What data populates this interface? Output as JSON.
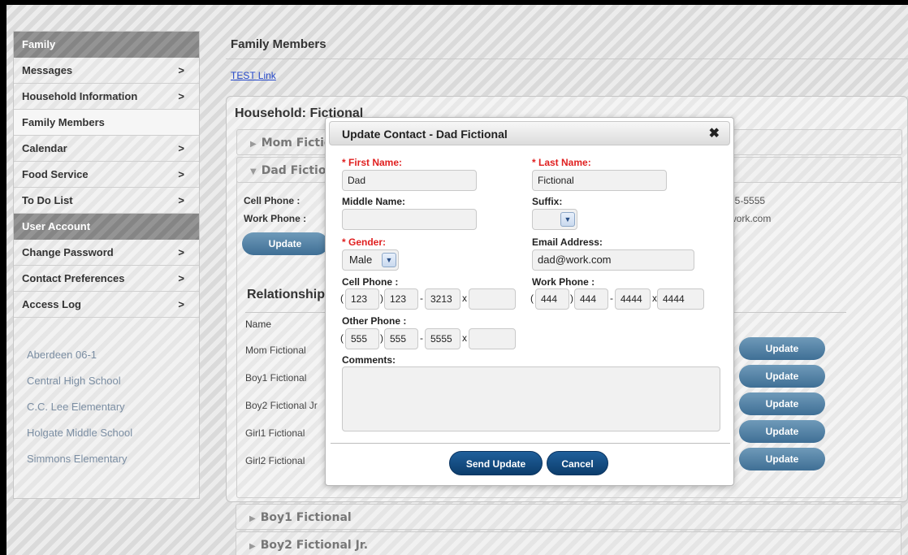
{
  "sidebar": {
    "family_header": "Family",
    "family_items": [
      {
        "label": "Messages",
        "chevron": ">"
      },
      {
        "label": "Household Information",
        "chevron": ">"
      },
      {
        "label": "Family Members",
        "chevron": ""
      },
      {
        "label": "Calendar",
        "chevron": ">"
      },
      {
        "label": "Food Service",
        "chevron": ">"
      },
      {
        "label": "To Do List",
        "chevron": ">"
      }
    ],
    "account_header": "User Account",
    "account_items": [
      {
        "label": "Change Password",
        "chevron": ">"
      },
      {
        "label": "Contact Preferences",
        "chevron": ">"
      },
      {
        "label": "Access Log",
        "chevron": ">"
      }
    ],
    "schools": [
      "Aberdeen 06-1",
      "Central High School",
      "C.C. Lee Elementary",
      "Holgate Middle School",
      "Simmons Elementary"
    ]
  },
  "main": {
    "title": "Family Members",
    "test_link": "TEST Link",
    "household_title": "Household: Fictional",
    "accordions": {
      "mom": "Mom Fictional",
      "dad": "Dad Fictional",
      "boy1": "Boy1 Fictional",
      "boy2": "Boy2 Fictional Jr."
    },
    "dad_details": {
      "cell_label": "Cell Phone :",
      "work_label": "Work Phone :",
      "cell_partial": "55-5555",
      "email_partial": "work.com",
      "update_label": "Update"
    },
    "relationships": {
      "title": "Relationships",
      "name_header": "Name",
      "rows": [
        {
          "name": "Mom Fictional",
          "button": "Update"
        },
        {
          "name": "Boy1 Fictional",
          "button": "Update"
        },
        {
          "name": "Boy2 Fictional Jr",
          "button": "Update"
        },
        {
          "name": "Girl1 Fictional",
          "button": "Update"
        },
        {
          "name": "Girl2 Fictional",
          "button": "Update"
        }
      ]
    }
  },
  "modal": {
    "title": "Update Contact - Dad Fictional",
    "close": "✖",
    "first_name_label": "* First Name:",
    "first_name_value": "Dad",
    "last_name_label": "* Last Name:",
    "last_name_value": "Fictional",
    "middle_name_label": "Middle Name:",
    "middle_name_value": "",
    "suffix_label": "Suffix:",
    "suffix_value": "",
    "gender_label": "* Gender:",
    "gender_value": "Male",
    "email_label": "Email Address:",
    "email_value": "dad@work.com",
    "cell_label": "Cell Phone :",
    "cell": {
      "area": "123",
      "prefix": "123",
      "line": "3213",
      "ext": ""
    },
    "work_label": "Work Phone :",
    "work": {
      "area": "444",
      "prefix": "444",
      "line": "4444",
      "ext": "4444"
    },
    "other_label": "Other Phone :",
    "other": {
      "area": "555",
      "prefix": "555",
      "line": "5555",
      "ext": ""
    },
    "comments_label": "Comments:",
    "comments_value": "",
    "send_label": "Send Update",
    "cancel_label": "Cancel",
    "phone_symbols": {
      "open": "(",
      "close": ")",
      "dash": "-",
      "ext": "x"
    }
  },
  "colors": {
    "required_label": "#e02020",
    "primary_button": "#0c3d6c",
    "secondary_button": "#3f6f95",
    "link": "#2346c8",
    "school_link": "#7b8ea3"
  }
}
